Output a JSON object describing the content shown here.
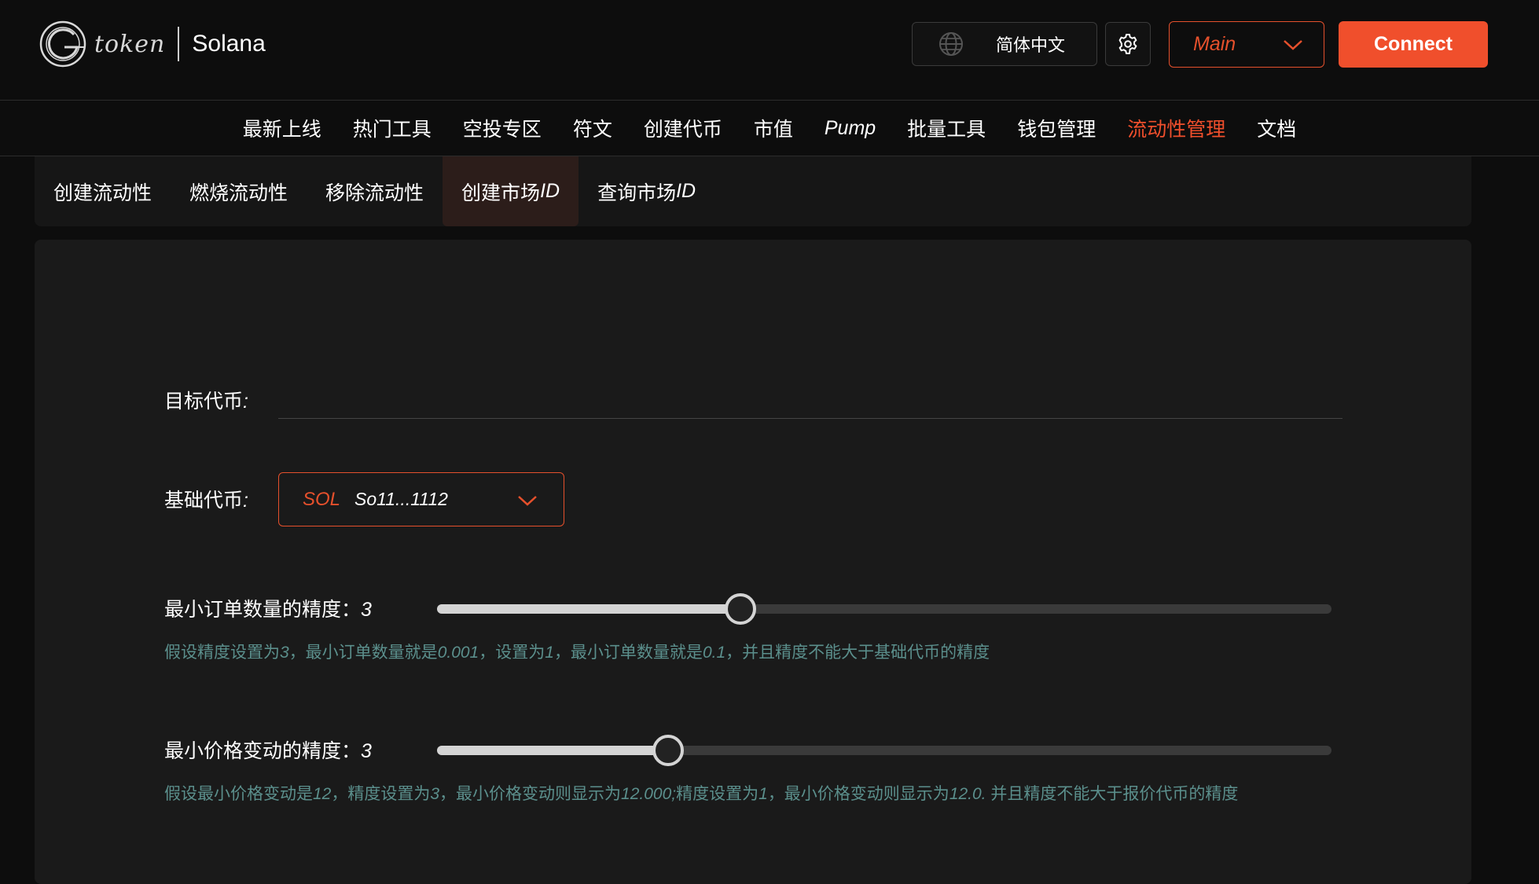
{
  "header": {
    "logo_text": "token",
    "chain": "Solana",
    "language_label": "简体中文",
    "network_label": "Main",
    "connect_label": "Connect",
    "icons": {
      "logo": "g-token-logo-icon",
      "language": "globe-icon",
      "settings": "gear-icon",
      "network_dropdown": "chevron-down-icon"
    }
  },
  "nav": {
    "items": [
      {
        "label": "最新上线"
      },
      {
        "label": "热门工具"
      },
      {
        "label": "空投专区"
      },
      {
        "label": "符文"
      },
      {
        "label": "创建代币"
      },
      {
        "label": "市值"
      },
      {
        "label": "Pump"
      },
      {
        "label": "批量工具"
      },
      {
        "label": "钱包管理"
      },
      {
        "label": "流动性管理"
      },
      {
        "label": "文档"
      }
    ],
    "active": "流动性管理"
  },
  "subtabs": {
    "items": [
      {
        "label": "创建流动性"
      },
      {
        "label": "燃烧流动性"
      },
      {
        "label": "移除流动性"
      },
      {
        "label": "创建市场",
        "suffix": "ID"
      },
      {
        "label": "查询市场",
        "suffix": "ID"
      }
    ],
    "active": "创建市场ID"
  },
  "form": {
    "target_token": {
      "label": "目标代币",
      "colon": ":",
      "value": ""
    },
    "base_token": {
      "label": "基础代币",
      "colon": ":",
      "symbol": "SOL",
      "address": "So11...1112"
    },
    "min_order_precision": {
      "label": "最小订单数量的精度：",
      "value": "3",
      "slider_fraction": 0.339,
      "hint": [
        {
          "t": "假设精度设置为"
        },
        {
          "t": "3",
          "i": true
        },
        {
          "t": "，最小订单数量就是"
        },
        {
          "t": "0.001",
          "i": true
        },
        {
          "t": "，设置为"
        },
        {
          "t": "1",
          "i": true
        },
        {
          "t": "，最小订单数量就是"
        },
        {
          "t": "0.1",
          "i": true
        },
        {
          "t": "，并且精度不能大于基础代币的精度"
        }
      ]
    },
    "min_price_precision": {
      "label": "最小价格变动的精度：",
      "value": "3",
      "slider_fraction": 0.258,
      "hint": [
        {
          "t": "假设最小价格变动是"
        },
        {
          "t": "12",
          "i": true
        },
        {
          "t": "，精度设置为"
        },
        {
          "t": "3",
          "i": true
        },
        {
          "t": "，最小价格变动则显示为"
        },
        {
          "t": "12.000;",
          "i": true
        },
        {
          "t": "精度设置为"
        },
        {
          "t": "1",
          "i": true
        },
        {
          "t": "，最小价格变动则显示为"
        },
        {
          "t": "12.0. ",
          "i": true
        },
        {
          "t": "并且精度不能大于报价代币的精度"
        }
      ]
    }
  },
  "colors": {
    "accent": "#f04f2c",
    "background": "#0d0d0d",
    "card": "#1a1a1a",
    "hint": "#5b8f8c"
  }
}
